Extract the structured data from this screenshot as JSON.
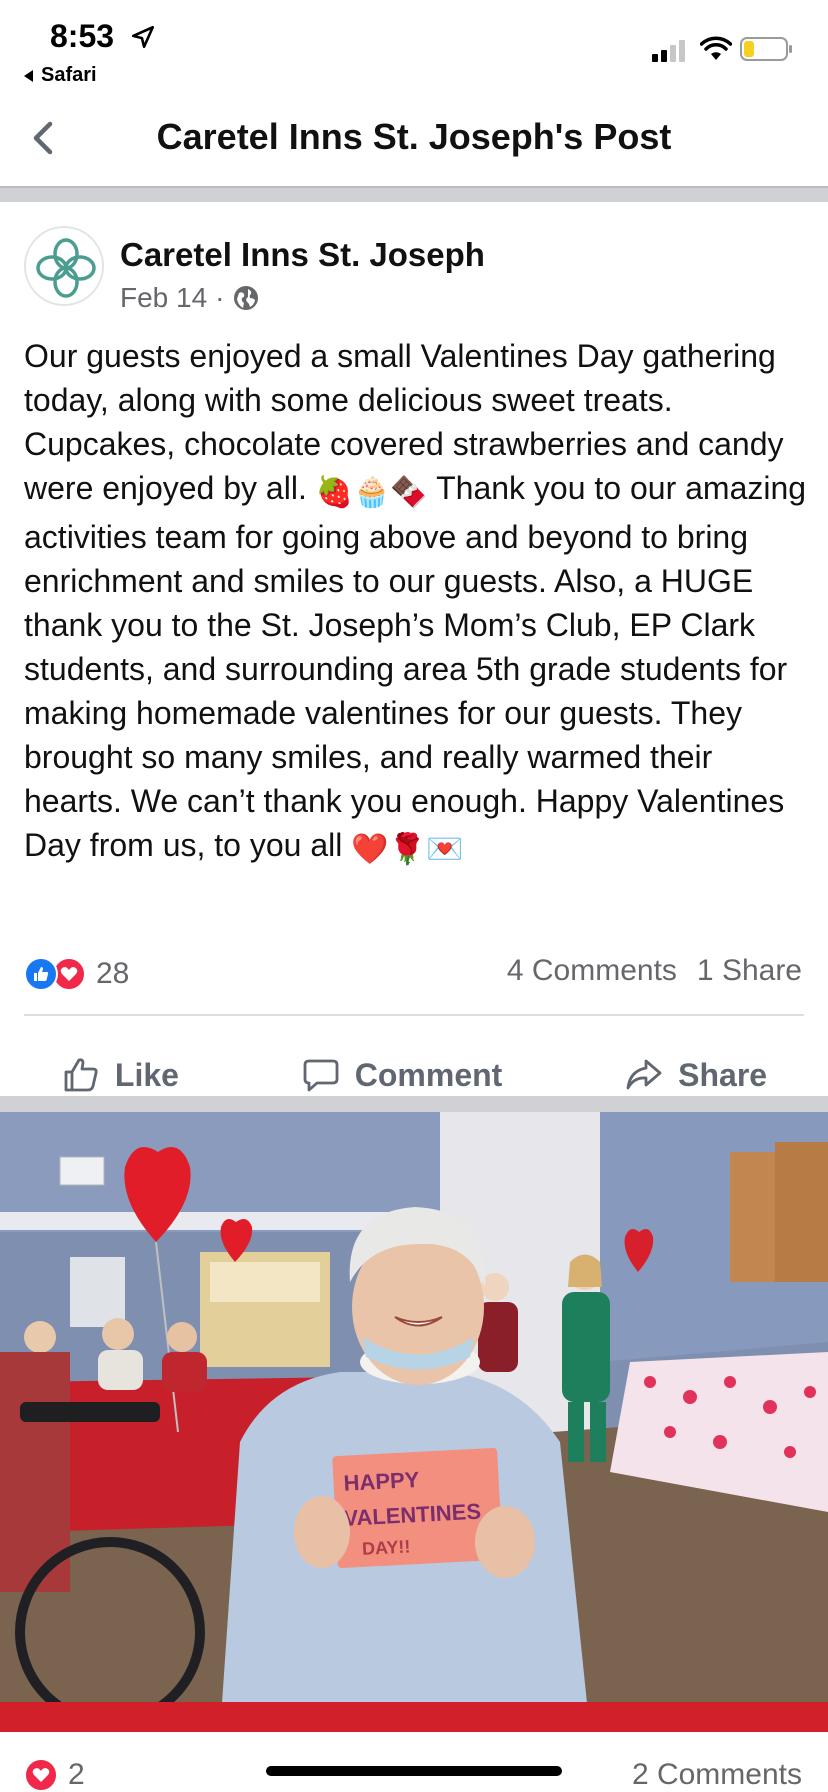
{
  "status_bar": {
    "time": "8:53",
    "back_app": "Safari",
    "battery_color": "#f5d020"
  },
  "nav": {
    "title": "Caretel Inns St. Joseph's Post"
  },
  "post": {
    "page_name": "Caretel Inns St. Joseph",
    "date": "Feb 14",
    "separator": "·",
    "text_part1": "Our guests enjoyed a small Valentines Day gathering today, along with some delicious sweet treats. Cupcakes, chocolate covered strawberries and candy were enjoyed by all.",
    "emoji1": "🍓🧁🍫",
    "text_part2": "Thank you to our amazing activities team for going above and beyond to bring enrichment and smiles to our guests. Also, a HUGE thank you to the St. Joseph’s Mom’s Club, EP Clark students, and surrounding area 5th grade students for making homemade valentines for our guests. They brought so many smiles, and really warmed their hearts. We can’t thank you enough. Happy Valentines Day from us, to you all",
    "emoji2": "❤️🌹💌",
    "reaction_count": "28",
    "comments": "4 Comments",
    "shares": "1 Share"
  },
  "actions": {
    "like": "Like",
    "comment": "Comment",
    "share": "Share"
  },
  "photo": {
    "card_text_line1": "HAPPY",
    "card_text_line2": "VALENTINES",
    "card_text_line3": "DAY!!"
  },
  "next_item": {
    "reaction_count": "2",
    "comments": "2 Comments"
  },
  "colors": {
    "like_blue": "#1877f2",
    "love_red": "#f02849",
    "secondary_text": "#65676b",
    "divider": "#cfd1d5",
    "logo_teal": "#4a9d8f"
  }
}
